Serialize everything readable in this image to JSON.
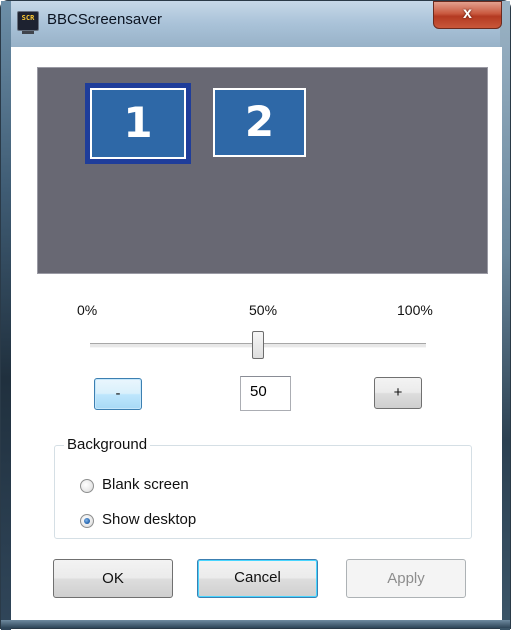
{
  "window": {
    "title": "BBCScreensaver",
    "icon_text": "SCR",
    "close_glyph": "x"
  },
  "preview": {
    "monitors": [
      {
        "label": "1",
        "selected": true
      },
      {
        "label": "2",
        "selected": false
      }
    ],
    "background_color": "#686873",
    "monitor_color": "#2e68a7"
  },
  "slider": {
    "min_label": "0%",
    "mid_label": "50%",
    "max_label": "100%",
    "value_fraction": 0.5
  },
  "stepper": {
    "minus_label": "-",
    "plus_label": "+",
    "value": "50"
  },
  "background_group": {
    "title": "Background",
    "options": [
      {
        "label": "Blank screen",
        "checked": false
      },
      {
        "label": "Show desktop",
        "checked": true
      }
    ]
  },
  "buttons": {
    "ok": "OK",
    "cancel": "Cancel",
    "apply": "Apply",
    "apply_enabled": false
  },
  "colors": {
    "close_button": "#c9583e",
    "selected_monitor_border": "#1f3d9a",
    "focus_blue": "#3c7fb1"
  }
}
